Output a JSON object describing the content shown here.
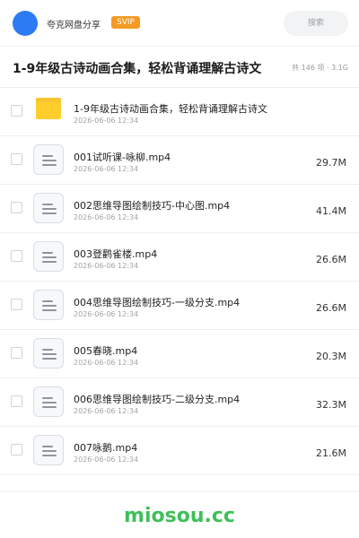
{
  "header": {
    "app_name": "夸克网盘分享",
    "svip_label": "SVIP",
    "search_label": "搜索"
  },
  "share": {
    "title": "1-9年级古诗动画合集，轻松背诵理解古诗文",
    "summary": "共 146 项 · 3.1G"
  },
  "items": [
    {
      "name": "1-9年级古诗动画合集，轻松背诵理解古诗文",
      "date": "2026-06-06 12:34",
      "size": "",
      "icon": "folder-icon"
    },
    {
      "name": "001试听课-咏柳.mp4",
      "date": "2026-06-06 12:34",
      "size": "29.7M",
      "icon": "file-icon"
    },
    {
      "name": "002思维导图绘制技巧-中心图.mp4",
      "date": "2026-06-06 12:34",
      "size": "41.4M",
      "icon": "file-icon"
    },
    {
      "name": "003登鹳雀楼.mp4",
      "date": "2026-06-06 12:34",
      "size": "26.6M",
      "icon": "file-icon"
    },
    {
      "name": "004思维导图绘制技巧-一级分支.mp4",
      "date": "2026-06-06 12:34",
      "size": "26.6M",
      "icon": "file-icon"
    },
    {
      "name": "005春晓.mp4",
      "date": "2026-06-06 12:34",
      "size": "20.3M",
      "icon": "file-icon"
    },
    {
      "name": "006思维导图绘制技巧-二级分支.mp4",
      "date": "2026-06-06 12:34",
      "size": "32.3M",
      "icon": "file-icon"
    },
    {
      "name": "007咏鹅.mp4",
      "date": "2026-06-06 12:34",
      "size": "21.6M",
      "icon": "file-icon"
    }
  ],
  "footer": {
    "watermark": "miosou.cc"
  },
  "colors": {
    "accent": "#2b7bf3",
    "svip": "#f59a23",
    "folder": "#ffce2d",
    "watermark": "#3fbf5a"
  }
}
